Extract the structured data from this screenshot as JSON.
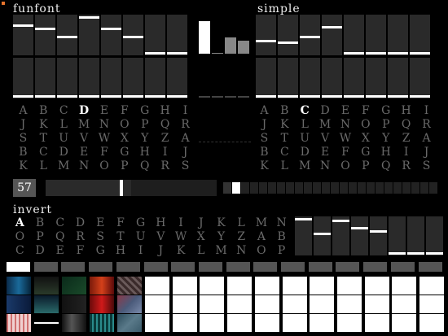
{
  "panels": {
    "funfont": {
      "title": "funfont",
      "upper_marks": [
        0.75,
        0.65,
        0.45,
        0.96,
        0.65,
        0.45,
        0.03,
        0.03
      ],
      "lower_marks": [
        0.03,
        0.03,
        0.03,
        0.03,
        0.03,
        0.03,
        0.03,
        0.03
      ],
      "letters": [
        [
          "A",
          "B",
          "C",
          "D",
          "E",
          "F",
          "G",
          "H",
          "I"
        ],
        [
          "J",
          "K",
          "L",
          "M",
          "N",
          "O",
          "P",
          "Q",
          "R"
        ],
        [
          "S",
          "T",
          "U",
          "V",
          "W",
          "X",
          "Y",
          "Z",
          "A"
        ],
        [
          "B",
          "C",
          "D",
          "E",
          "F",
          "G",
          "H",
          "I",
          "J"
        ],
        [
          "K",
          "L",
          "M",
          "N",
          "O",
          "P",
          "Q",
          "R",
          "S"
        ]
      ],
      "selected_letter": "D"
    },
    "simple": {
      "title": "simple",
      "upper_marks": [
        0.35,
        0.3,
        0.45,
        0.7,
        0.03,
        0.03,
        0.03,
        0.03
      ],
      "lower_marks": [
        0.03,
        0.03,
        0.03,
        0.03,
        0.03,
        0.03,
        0.03,
        0.03
      ],
      "letters": [
        [
          "A",
          "B",
          "C",
          "D",
          "E",
          "F",
          "G",
          "H",
          "I"
        ],
        [
          "J",
          "K",
          "L",
          "M",
          "N",
          "O",
          "P",
          "Q",
          "R"
        ],
        [
          "S",
          "T",
          "U",
          "V",
          "W",
          "X",
          "Y",
          "Z",
          "A"
        ],
        [
          "B",
          "C",
          "D",
          "E",
          "F",
          "G",
          "H",
          "I",
          "J"
        ],
        [
          "K",
          "L",
          "M",
          "N",
          "O",
          "P",
          "Q",
          "R",
          "S"
        ]
      ],
      "selected_letter": "C"
    },
    "invert": {
      "title": "invert",
      "marks": [
        0.95,
        0.55,
        0.9,
        0.72,
        0.62,
        0.03,
        0.03,
        0.03
      ],
      "letters": [
        [
          "A",
          "B",
          "C",
          "D",
          "E",
          "F",
          "G",
          "H",
          "I",
          "J",
          "K",
          "L",
          "M",
          "N"
        ],
        [
          "O",
          "P",
          "Q",
          "R",
          "S",
          "T",
          "U",
          "V",
          "W",
          "X",
          "Y",
          "Z",
          "A",
          "B"
        ],
        [
          "C",
          "D",
          "E",
          "F",
          "G",
          "H",
          "I",
          "J",
          "K",
          "L",
          "M",
          "N",
          "O",
          "P"
        ]
      ],
      "selected_letter": "A"
    }
  },
  "meters": {
    "levels": [
      1.0,
      0.03,
      0.5,
      0.4
    ],
    "low_levels": [
      0.1,
      0.1,
      0.2,
      0.2
    ]
  },
  "counter": {
    "value": "57",
    "position": 0.5
  },
  "steps": {
    "count": 24,
    "active": 1
  },
  "tabs": {
    "count": 16,
    "active": 0
  },
  "colors": {
    "accent": "#e8742c",
    "slider_bg": "#2a2a2a",
    "letter_dim": "#6a6a6a"
  }
}
